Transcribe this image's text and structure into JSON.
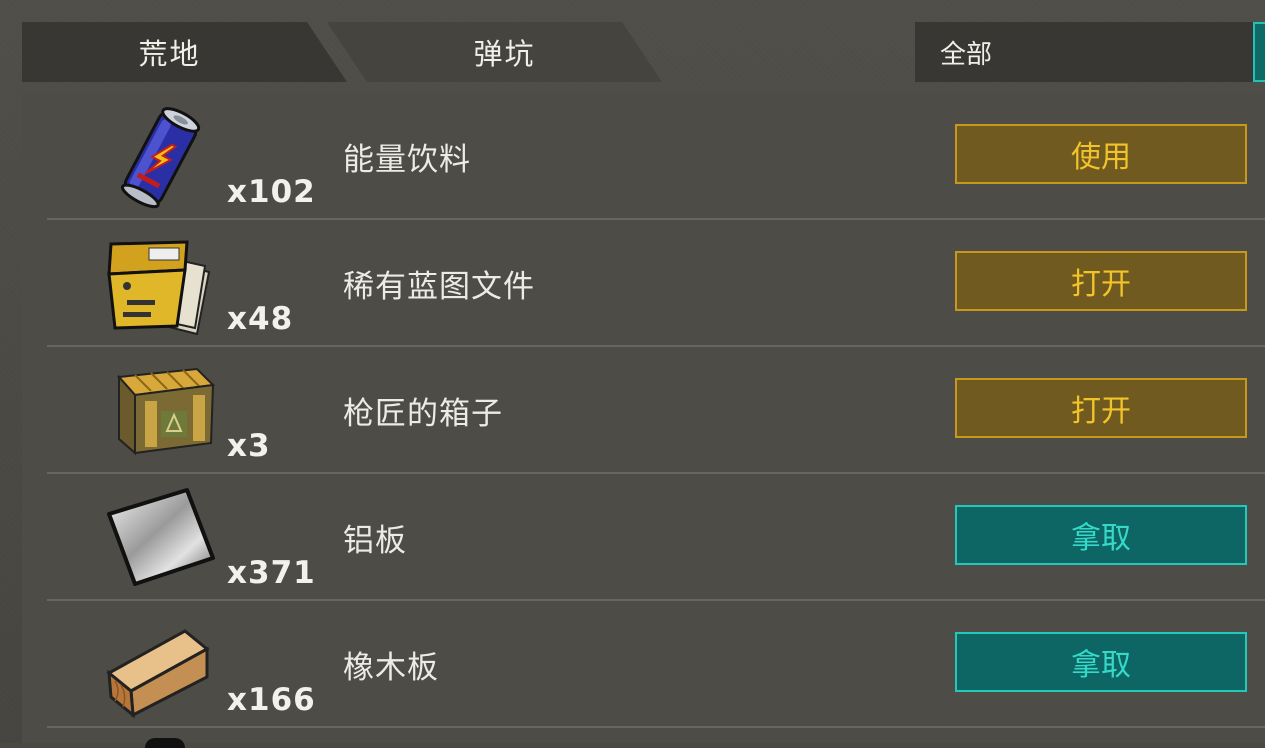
{
  "tabs": [
    {
      "label": "荒地"
    },
    {
      "label": "弹坑"
    }
  ],
  "filter": {
    "label": "全部"
  },
  "items": [
    {
      "name": "能量饮料",
      "qty": "x102",
      "action": "使用",
      "icon": "energy-drink-can-icon"
    },
    {
      "name": "稀有蓝图文件",
      "qty": "x48",
      "action": "打开",
      "icon": "blueprint-binder-icon"
    },
    {
      "name": "枪匠的箱子",
      "qty": "x3",
      "action": "打开",
      "icon": "wooden-crate-icon"
    },
    {
      "name": "铝板",
      "qty": "x371",
      "action": "拿取",
      "icon": "aluminum-sheet-icon"
    },
    {
      "name": "橡木板",
      "qty": "x166",
      "action": "拿取",
      "icon": "oak-plank-icon"
    }
  ],
  "colors": {
    "use_button": "#715a20",
    "take_button": "#0e6664",
    "yellow_text": "#f2c429",
    "teal_text": "#34d9c9"
  }
}
